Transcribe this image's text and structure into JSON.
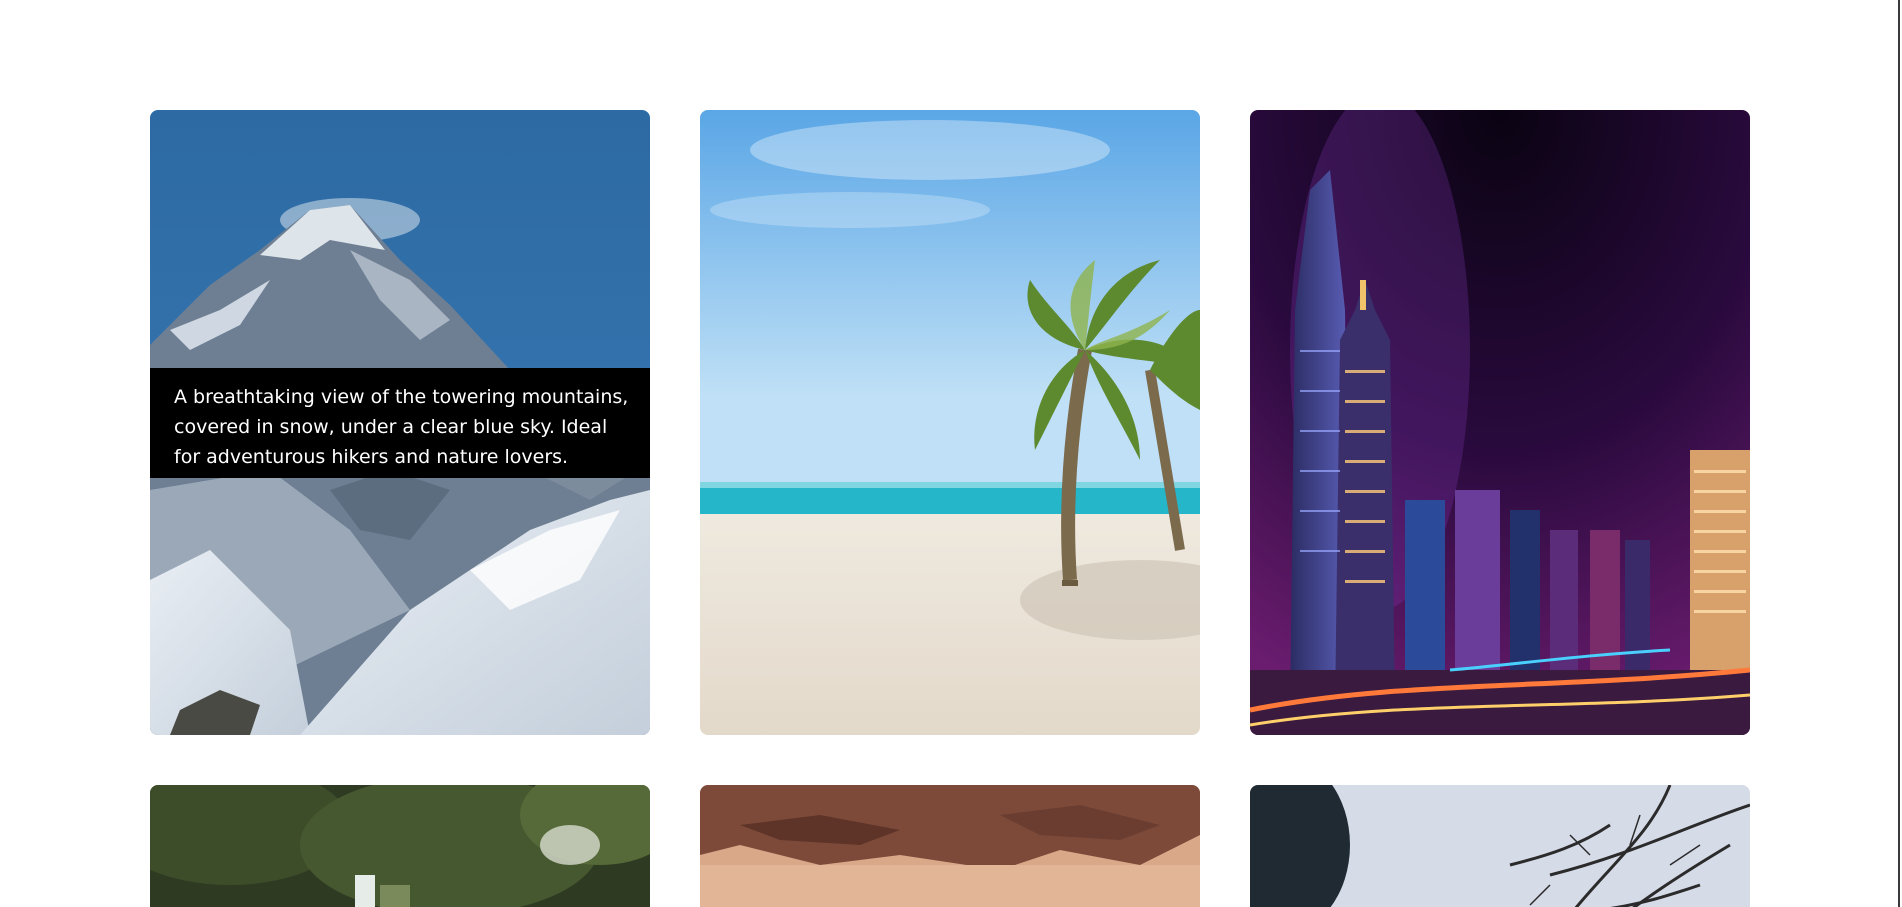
{
  "gallery": {
    "cards": [
      {
        "name": "mountain",
        "caption": "A breathtaking view of the towering mountains, covered in snow, under a clear blue sky. Ideal for adventurous hikers and nature lovers."
      },
      {
        "name": "beach"
      },
      {
        "name": "city-night"
      },
      {
        "name": "forest-waterfall"
      },
      {
        "name": "desert"
      },
      {
        "name": "winter-branches"
      }
    ]
  },
  "colors": {
    "page_background": "#ffffff",
    "caption_background": "#000000",
    "caption_text": "#ffffff"
  }
}
